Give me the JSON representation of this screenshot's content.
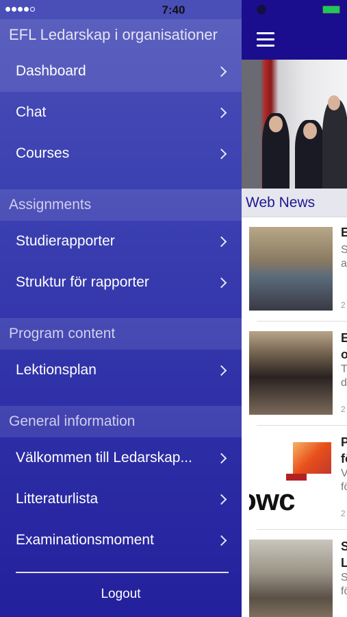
{
  "status": {
    "time": "7:40"
  },
  "drawer": {
    "title": "EFL Ledarskap i organisationer",
    "items_top": [
      {
        "label": "Dashboard",
        "icon": "chevron-right-icon"
      },
      {
        "label": "Chat",
        "icon": "chevron-right-icon"
      },
      {
        "label": "Courses",
        "icon": "chevron-right-icon"
      }
    ],
    "sections": [
      {
        "title": "Assignments",
        "items": [
          {
            "label": "Studierapporter"
          },
          {
            "label": "Struktur för rapporter"
          }
        ]
      },
      {
        "title": "Program content",
        "items": [
          {
            "label": "Lektionsplan"
          }
        ]
      },
      {
        "title": "General information",
        "items": [
          {
            "label": "Välkommen till Ledarskap..."
          },
          {
            "label": "Litteraturlista"
          },
          {
            "label": "Examinationsmoment"
          }
        ]
      }
    ],
    "logout_label": "Logout"
  },
  "main": {
    "section_title": "Web News",
    "news": [
      {
        "title": "E",
        "snippet": "S\na",
        "date": "2"
      },
      {
        "title": "E\no",
        "snippet": "T\nd",
        "date": "2"
      },
      {
        "title": "P\nfö",
        "snippet": "V\nfö",
        "date": "2"
      },
      {
        "title": "S\nL",
        "snippet": "S\nfö",
        "date": ""
      }
    ],
    "thumb_text": "owc"
  },
  "colors": {
    "drawer_bg": "#3a3fb0",
    "navbar_bg": "#1b0e8e",
    "accent_text": "#1b1790"
  }
}
